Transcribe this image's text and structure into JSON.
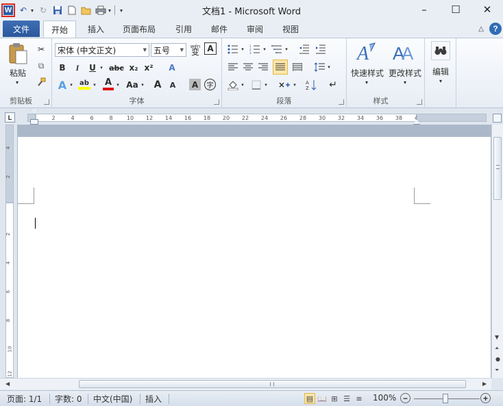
{
  "window": {
    "title": "文档1 - Microsoft Word",
    "app_logo": "W",
    "minimize": "–",
    "maximize": "☐",
    "close": "✕"
  },
  "quick_access": {
    "undo": "↶",
    "redo": "↻",
    "save": "▪",
    "new": "▫",
    "open": "▰",
    "print": "▤",
    "customize": "▾"
  },
  "tabs": {
    "file": "文件",
    "items": [
      "开始",
      "插入",
      "页面布局",
      "引用",
      "邮件",
      "审阅",
      "视图"
    ],
    "active": "开始",
    "collapse": "△",
    "help": "?"
  },
  "ribbon": {
    "clipboard": {
      "title": "剪贴板",
      "paste": "粘贴",
      "cut": "✂",
      "copy": "⧉",
      "format_painter": "🖌"
    },
    "font": {
      "title": "字体",
      "font_name": "宋体 (中文正文)",
      "font_size": "五号",
      "pinyin": "wén",
      "border_char": "A",
      "bold": "B",
      "italic": "I",
      "underline": "U",
      "strike": "abc",
      "subscript": "x₂",
      "superscript": "x²",
      "clear": "A",
      "text_effect": "A",
      "highlight": "ab",
      "font_color": "A",
      "change_case": "Aa",
      "grow": "A",
      "shrink": "A",
      "shading": "A",
      "enclose": "字"
    },
    "paragraph": {
      "title": "段落"
    },
    "styles": {
      "title": "样式",
      "quick": "快速样式",
      "change": "更改样式"
    },
    "editing": {
      "label": "编辑"
    }
  },
  "ruler": {
    "tab_selector": "L",
    "ticks": [
      "2",
      "4",
      "6",
      "8",
      "10",
      "12",
      "14",
      "16",
      "18",
      "20",
      "22",
      "24",
      "26",
      "28",
      "30",
      "32",
      "34",
      "36",
      "38",
      "40",
      "42",
      "44",
      "46"
    ],
    "vticks": [
      "4",
      "2",
      "2",
      "4",
      "6",
      "8",
      "10",
      "12"
    ]
  },
  "status": {
    "page": "页面: 1/1",
    "words": "字数: 0",
    "language": "中文(中国)",
    "mode": "插入",
    "zoom": "100%",
    "zoom_out": "−",
    "zoom_in": "+"
  },
  "colors": {
    "file_tab": "#2b579a",
    "highlight": "#ffff00",
    "font_color": "#e01010",
    "logo_border": "#e0271c"
  }
}
